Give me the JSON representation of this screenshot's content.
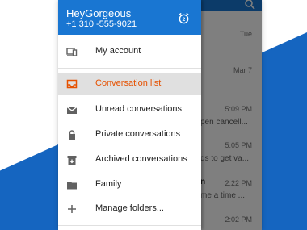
{
  "colors": {
    "primary": "#1976d2",
    "accent": "#e65100",
    "brand_band": "#1565c0"
  },
  "drawer": {
    "title": "HeyGorgeous",
    "phone": "+1 310 -555-9021",
    "header_icon": "alarm-icon",
    "items": [
      {
        "label": "My account",
        "icon": "devices-icon"
      },
      {
        "label": "Conversation list",
        "icon": "inbox-icon",
        "active": true
      },
      {
        "label": "Unread conversations",
        "icon": "mail-icon"
      },
      {
        "label": "Private conversations",
        "icon": "lock-icon"
      },
      {
        "label": "Archived conversations",
        "icon": "archive-icon"
      },
      {
        "label": "Family",
        "icon": "folder-icon"
      },
      {
        "label": "Manage folders...",
        "icon": "plus-icon"
      }
    ]
  },
  "conversations": {
    "dates": [
      "Tue",
      "Mar 7",
      "5:09 PM",
      "5:05 PM",
      "2:22 PM",
      "2:02 PM"
    ],
    "snippets": [
      "pen cancell...",
      "ds to get va...",
      "me a time ..."
    ],
    "name_fragment": "n"
  }
}
